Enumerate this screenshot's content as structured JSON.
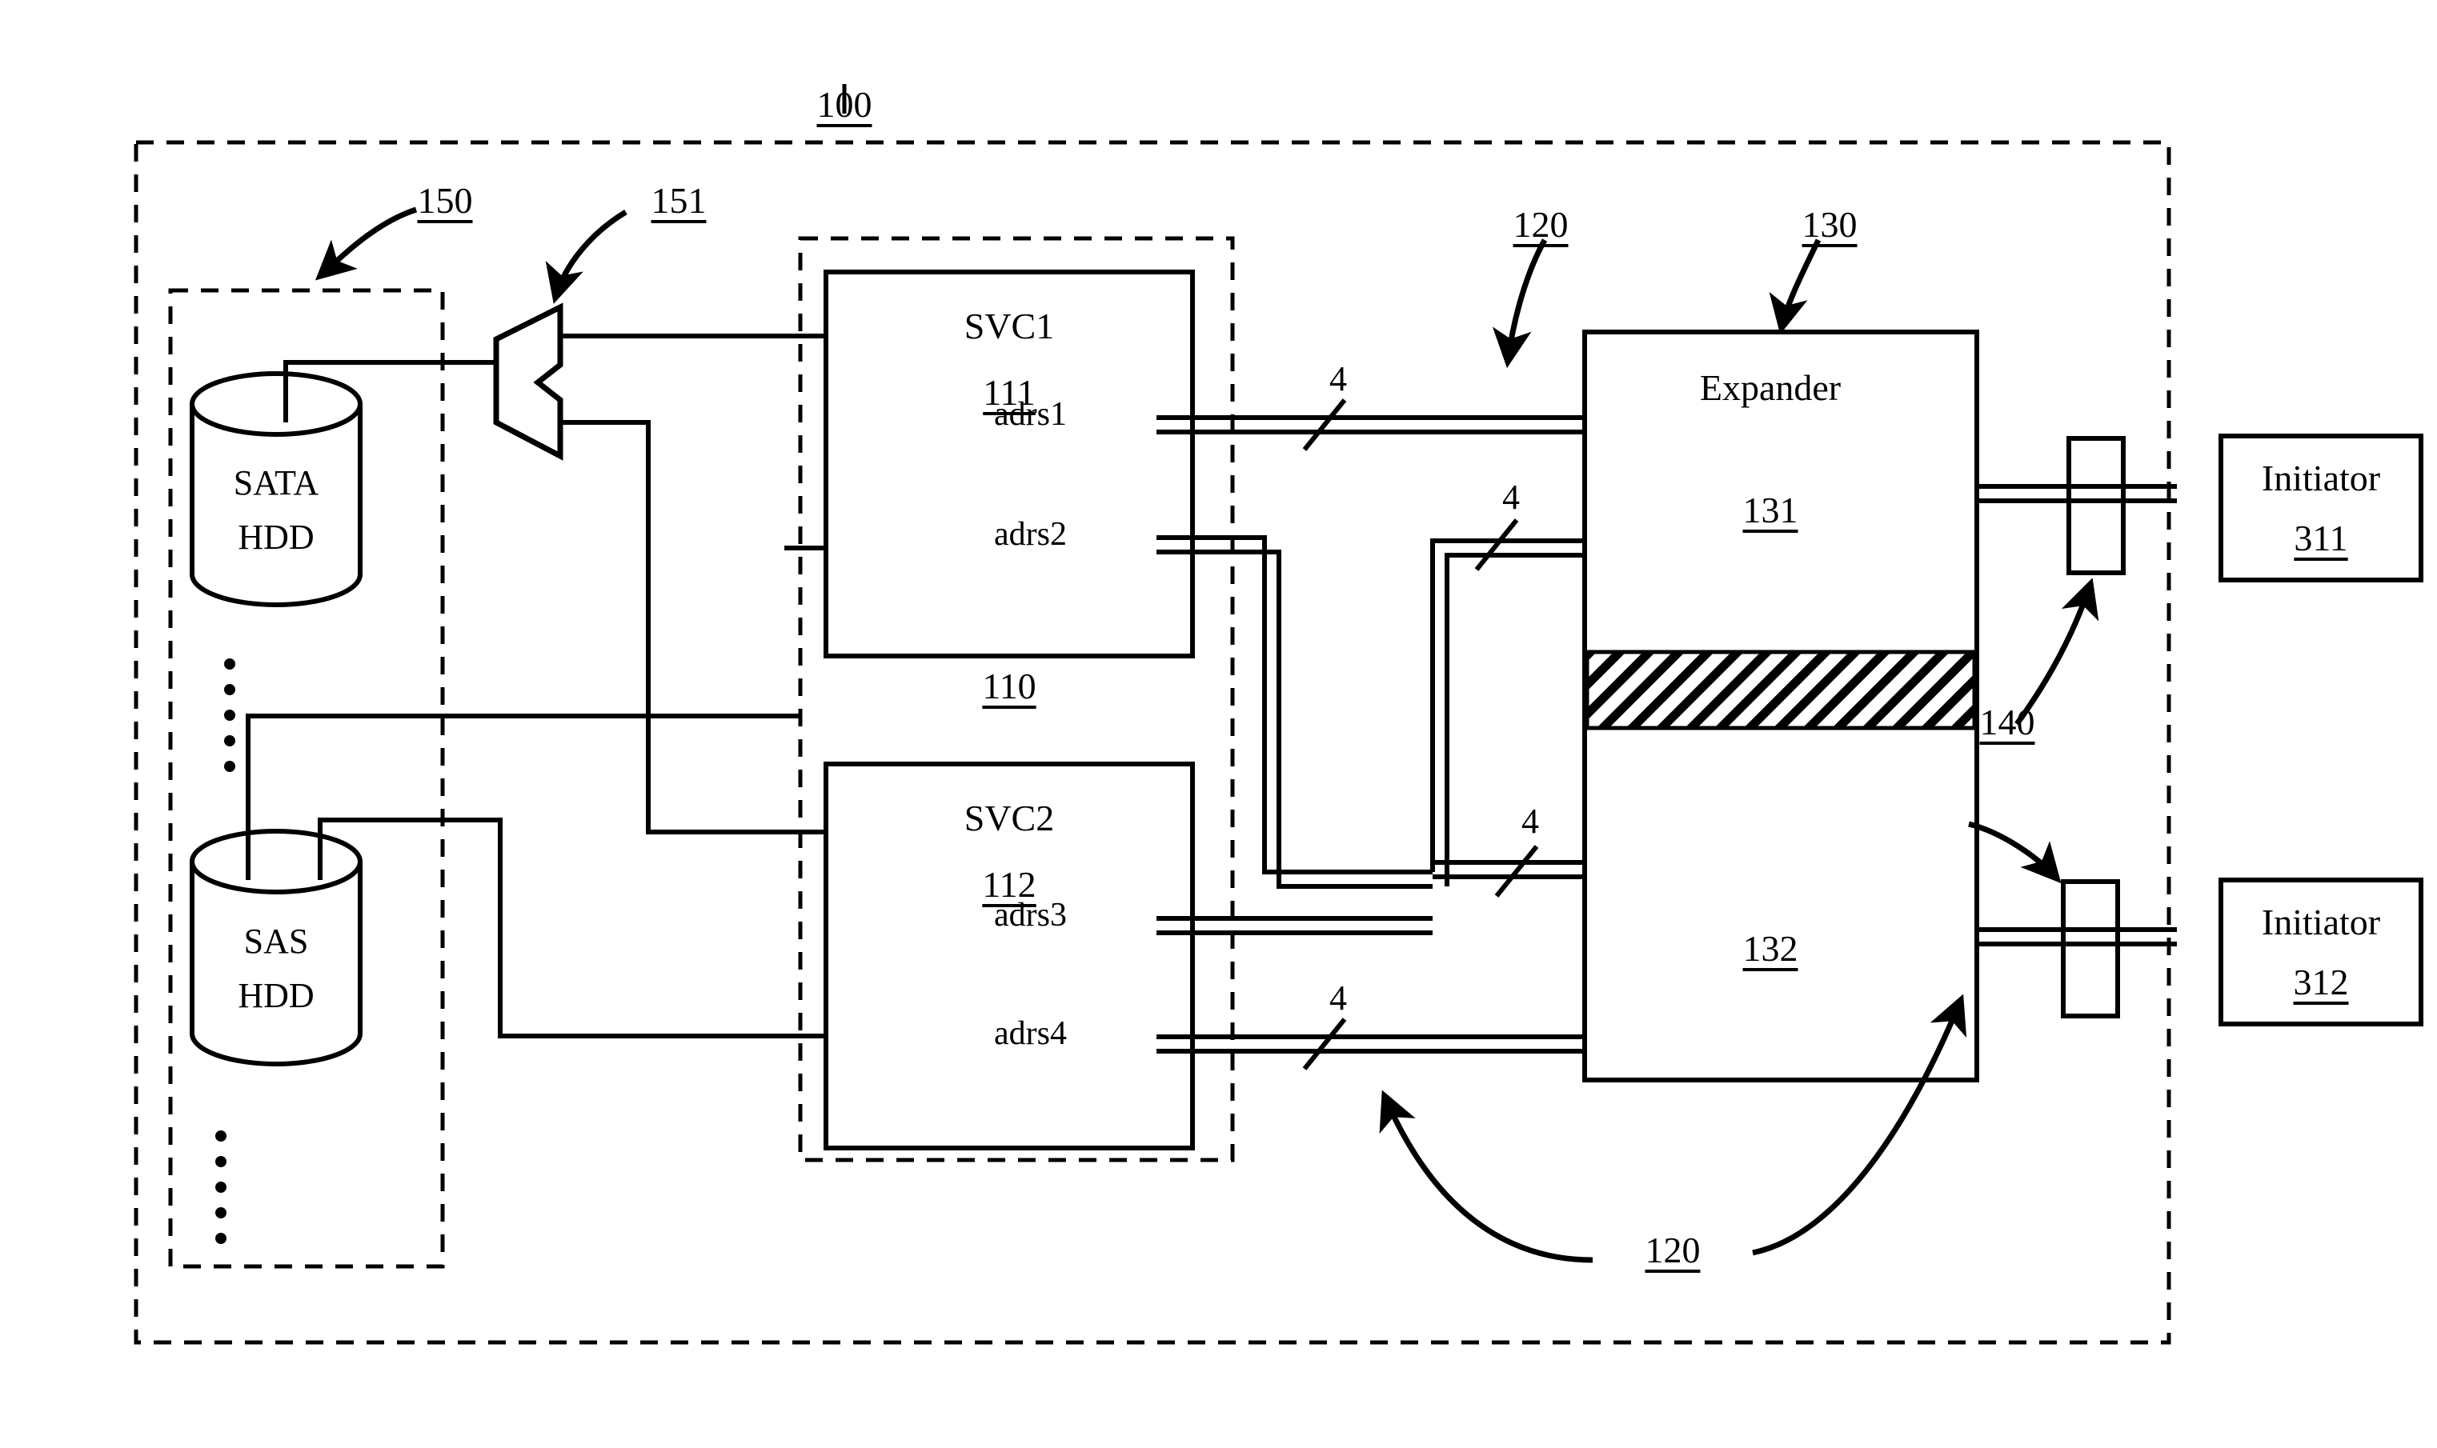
{
  "figure": {
    "title_ref": "100",
    "type": "patent-block-diagram"
  },
  "refs": {
    "system": "100",
    "drive_array": "150",
    "multiplexer": "151",
    "controller_pair": "110",
    "svc1": "111",
    "svc2": "112",
    "bus_top": "120",
    "bus_bottom": "120",
    "expander_unit": "130",
    "expander_upper": "131",
    "expander_lower": "132",
    "connector": "140"
  },
  "drives": [
    {
      "name": "drive-sata",
      "line1": "SATA",
      "line2": "HDD"
    },
    {
      "name": "drive-sas",
      "line1": "SAS",
      "line2": "HDD"
    }
  ],
  "controllers": [
    {
      "name": "SVC1",
      "ref": "111",
      "ports": [
        "adrs1",
        "adrs2"
      ]
    },
    {
      "name": "SVC2",
      "ref": "112",
      "ports": [
        "adrs3",
        "adrs4"
      ]
    }
  ],
  "expander": {
    "label": "Expander",
    "upper_ref": "131",
    "lower_ref": "132"
  },
  "initiators": [
    {
      "label": "Initiator",
      "ref": "311"
    },
    {
      "label": "Initiator",
      "ref": "312"
    }
  ],
  "bus_widths": [
    "4",
    "4",
    "4",
    "4"
  ],
  "ellipsis_glyph": "·",
  "colors": {
    "line": "#000000",
    "background": "#ffffff",
    "hatch": "#000000"
  }
}
